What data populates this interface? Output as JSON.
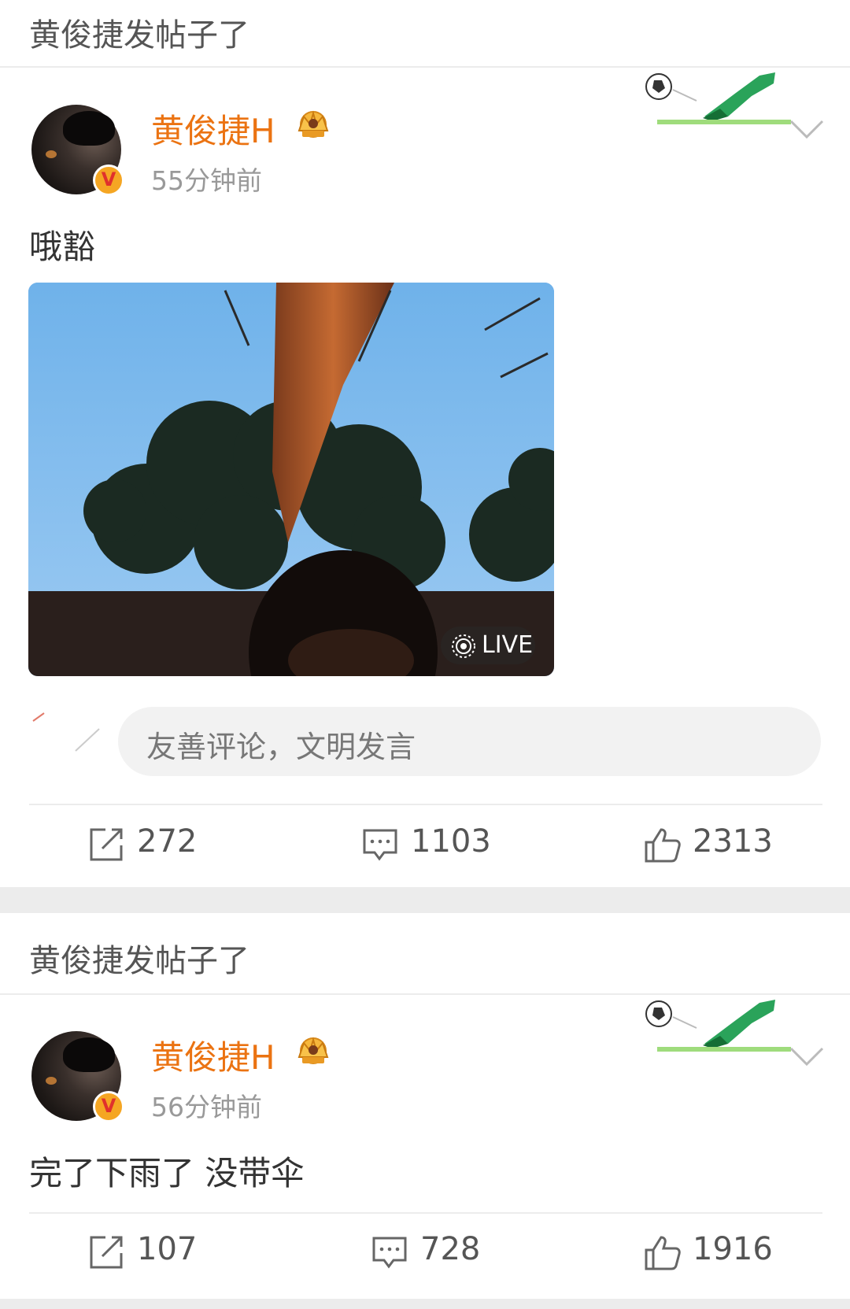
{
  "posts": [
    {
      "header": "黄俊捷发帖子了",
      "username": "黄俊捷H",
      "time": "55分钟前",
      "text": "哦豁",
      "live_label": "LIVE",
      "comment_placeholder": "友善评论，文明发言",
      "verified_badge": "V",
      "actions": {
        "repost": "272",
        "comment": "1103",
        "like": "2313"
      }
    },
    {
      "header": "黄俊捷发帖子了",
      "username": "黄俊捷H",
      "time": "56分钟前",
      "text": "完了下雨了 没带伞",
      "verified_badge": "V",
      "actions": {
        "repost": "107",
        "comment": "728",
        "like": "1916"
      }
    }
  ],
  "colors": {
    "username": "#eb7312",
    "divider": "#ececec",
    "badge": "#f5a623"
  },
  "icons": [
    "crown-icon",
    "chevron-down-icon",
    "repost-icon",
    "comment-icon",
    "like-icon",
    "live-icon",
    "football-icon"
  ]
}
